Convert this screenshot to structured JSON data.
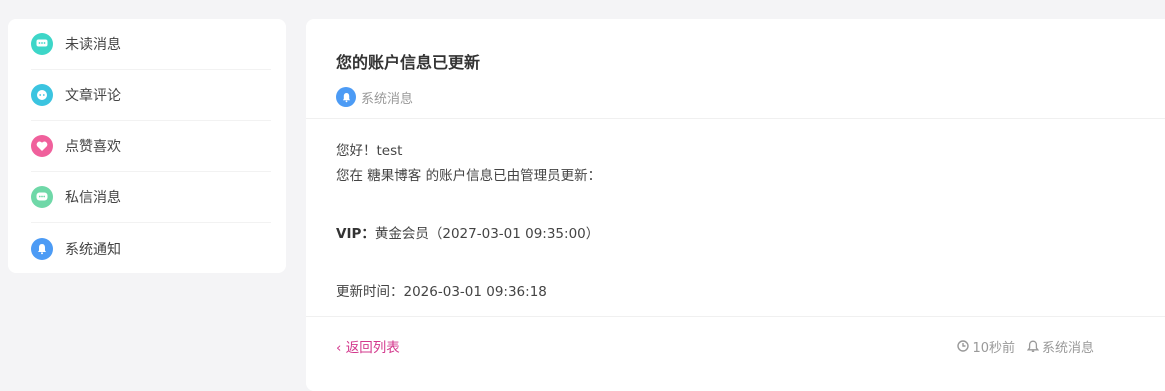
{
  "sidebar": {
    "items": [
      {
        "label": "未读消息",
        "icon": "chat-bubble-icon",
        "color": "#3dd6c8"
      },
      {
        "label": "文章评论",
        "icon": "comment-icon",
        "color": "#3bc4e0"
      },
      {
        "label": "点赞喜欢",
        "icon": "heart-icon",
        "color": "#f0609c"
      },
      {
        "label": "私信消息",
        "icon": "private-message-icon",
        "color": "#6fd8a8"
      },
      {
        "label": "系统通知",
        "icon": "bell-icon",
        "color": "#4c9bf5"
      }
    ]
  },
  "message": {
    "title": "您的账户信息已更新",
    "category": "系统消息",
    "greeting": "您好！test",
    "intro": "您在 糖果博客 的账户信息已由管理员更新：",
    "vip_label": "VIP：",
    "vip_value": "黄金会员（2027-03-01 09:35:00）",
    "updated": "更新时间：2026-03-01 09:36:18"
  },
  "footer": {
    "back": "‹ 返回列表",
    "time": "10秒前",
    "type": "系统消息"
  }
}
